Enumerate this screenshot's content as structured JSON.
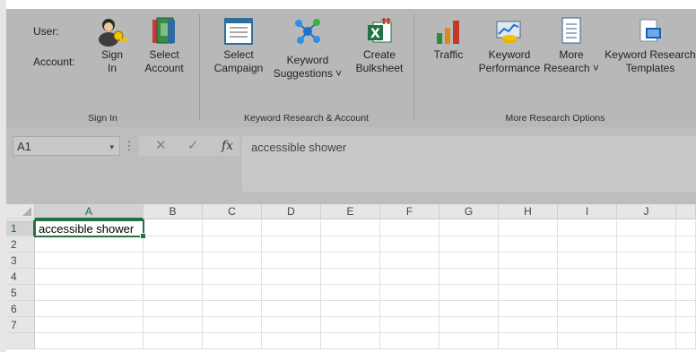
{
  "ribbon": {
    "sign_in_group": {
      "user_label": "User:",
      "account_label": "Account:",
      "sign_in": "Sign\nIn",
      "select_account": "Select\nAccount",
      "group_label": "Sign In"
    },
    "keyword_group": {
      "select_campaign": "Select\nCampaign",
      "keyword_suggestions": "Keyword\nSuggestions ˅",
      "create_bulksheet": "Create\nBulksheet",
      "group_label": "Keyword Research & Account"
    },
    "research_group": {
      "traffic": "Traffic",
      "keyword_performance": "Keyword\nPerformance",
      "more_research": "More\nResearch ˅",
      "keyword_research_templates": "Keyword Research\nTemplates",
      "group_label": "More Research Options"
    }
  },
  "formula_bar": {
    "name_box": "A1",
    "formula": "accessible shower"
  },
  "grid": {
    "columns": [
      "A",
      "B",
      "C",
      "D",
      "E",
      "F",
      "G",
      "H",
      "I",
      "J"
    ],
    "rows": [
      "1",
      "2",
      "3",
      "4",
      "5",
      "6",
      "7"
    ],
    "cells": {
      "A1": "accessible shower"
    }
  },
  "colors": {
    "accent": "#217346",
    "ribbon_bg": "#b8b8b8"
  }
}
